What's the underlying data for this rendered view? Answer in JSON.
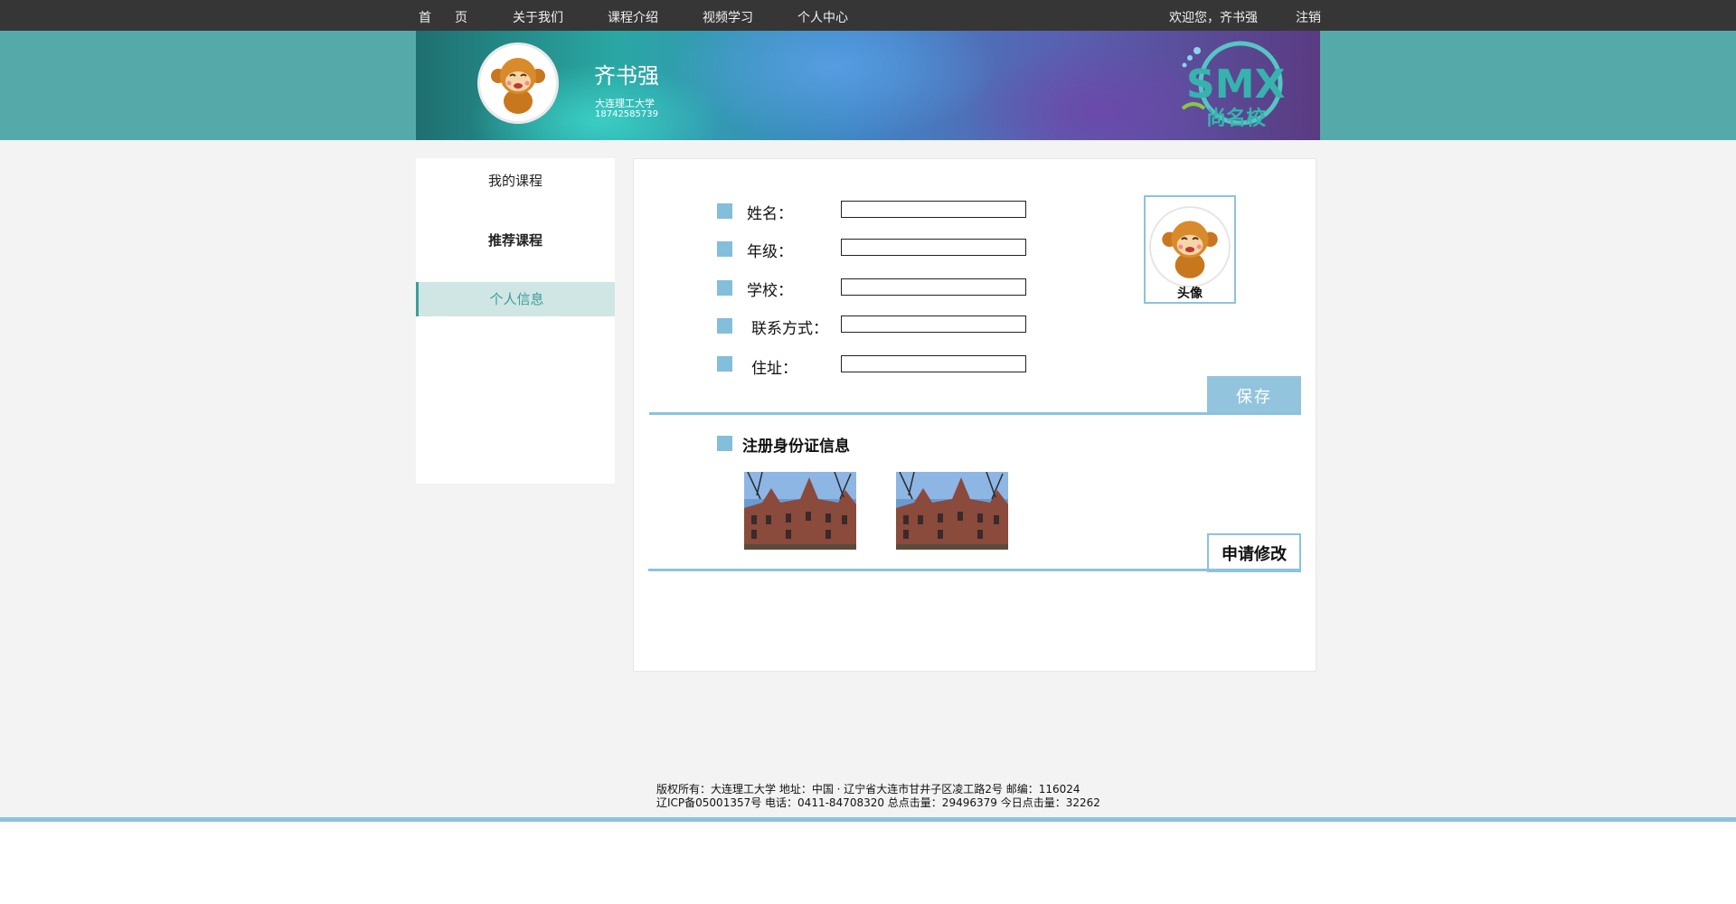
{
  "nav": {
    "home": "首页",
    "about": "关于我们",
    "courses": "课程介绍",
    "video": "视频学习",
    "personal_center": "个人中心",
    "welcome": "欢迎您，齐书强",
    "logout": "注销"
  },
  "banner": {
    "name": "齐书强",
    "school": "大连理工大学",
    "phone": "18742585739",
    "logo_text": "SMX",
    "logo_subtext": "尚名校"
  },
  "sidebar": {
    "items": [
      {
        "label": "我的课程"
      },
      {
        "label": "推荐课程"
      },
      {
        "label": "个人信息"
      }
    ],
    "active_index": 2
  },
  "form": {
    "fields": [
      {
        "label": "姓名：",
        "value": ""
      },
      {
        "label": "年级：",
        "value": ""
      },
      {
        "label": "学校：",
        "value": ""
      },
      {
        "label": "联系方式：",
        "value": ""
      },
      {
        "label": "住址：",
        "value": ""
      }
    ],
    "avatar_caption": "头像",
    "save_label": "保存"
  },
  "id_section": {
    "title": "注册身份证信息",
    "apply_label": "申请修改"
  },
  "footer": {
    "line1": "版权所有：大连理工大学  地址：中国 · 辽宁省大连市甘井子区凌工路2号  邮编：116024",
    "line2": "辽ICP备05001357号  电话：0411-84708320 总点击量：29496379 今日点击量：32262"
  },
  "colors": {
    "topbar": "#363636",
    "banner_strip": "#56a9a9",
    "accent_blue": "#8cc2dc",
    "active_teal": "#3e9c98",
    "active_bg": "#cfe6e5"
  }
}
